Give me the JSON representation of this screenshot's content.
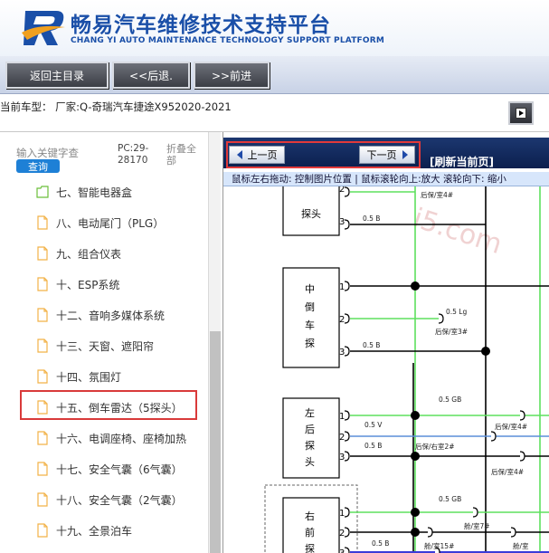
{
  "header": {
    "brand_cn": "畅易汽车维修技术支持平台",
    "brand_en": "CHANG YI AUTO MAINTENANCE TECHNOLOGY SUPPORT PLATFORM"
  },
  "toolbar": {
    "home_label": "返回主目录",
    "back_label": "<<后退.",
    "forward_label": ">>前进"
  },
  "model": {
    "text": "当前车型：  厂家:Q-奇瑞汽车捷途X952020-2021"
  },
  "left": {
    "search_placeholder": "输入关键字查",
    "query_label": "查询",
    "pc_code": "PC:29-28170",
    "fold_all_label": "折叠全部",
    "items": [
      {
        "label": "七、智能电器盒",
        "type": "folder"
      },
      {
        "label": "八、电动尾门（PLG）",
        "type": "doc"
      },
      {
        "label": "九、组合仪表",
        "type": "doc"
      },
      {
        "label": "十、ESP系统",
        "type": "doc"
      },
      {
        "label": "十二、音响多媒体系统",
        "type": "doc"
      },
      {
        "label": "十三、天窗、遮阳帘",
        "type": "doc"
      },
      {
        "label": "十四、氛围灯",
        "type": "doc"
      },
      {
        "label": "十五、倒车雷达（5探头）",
        "type": "doc"
      },
      {
        "label": "十六、电调座椅、座椅加热",
        "type": "doc"
      },
      {
        "label": "十七、安全气囊（6气囊）",
        "type": "doc"
      },
      {
        "label": "十八、安全气囊（2气囊）",
        "type": "doc"
      },
      {
        "label": "十九、全景泊车",
        "type": "doc"
      }
    ]
  },
  "right": {
    "prev_page": "上一页",
    "next_page": "下一页",
    "refresh_label": "[刷新当前页]",
    "hint": "鼠标左右拖动: 控制图片位置 | 鼠标滚轮向上:放大  滚轮向下: 缩小"
  },
  "diagram": {
    "watermark": "i5.com",
    "probe_top": "探头",
    "probe_mid": "中倒车探头",
    "probe_left": "左后探头",
    "probe_right": "右前探头",
    "pins": [
      "2",
      "3",
      "1",
      "2",
      "3",
      "1",
      "2",
      "3",
      "1",
      "2",
      "3"
    ],
    "wires": {
      "w1": "后保/室4#",
      "w2": "0.5 B",
      "w3": "0.5 Lg",
      "w4": "后保/室3#",
      "w5": "0.5 B",
      "w6": "0.5 GB",
      "w7": "0.5 V",
      "w8": "后保/室4#",
      "w9": "0.5 B",
      "w10": "后保/右室2#",
      "w11": "后保/室4#",
      "w12": "0.5 GB",
      "w13": "舱/室7#",
      "w14": "0.5 B",
      "w15": "舱/室15#",
      "w16": "舱/室"
    }
  },
  "colors": {
    "accent": "#1a4fa8",
    "wire_green": "#5ee05e",
    "wire_blue": "#5b8fd8",
    "highlight": "#d93a3a"
  }
}
